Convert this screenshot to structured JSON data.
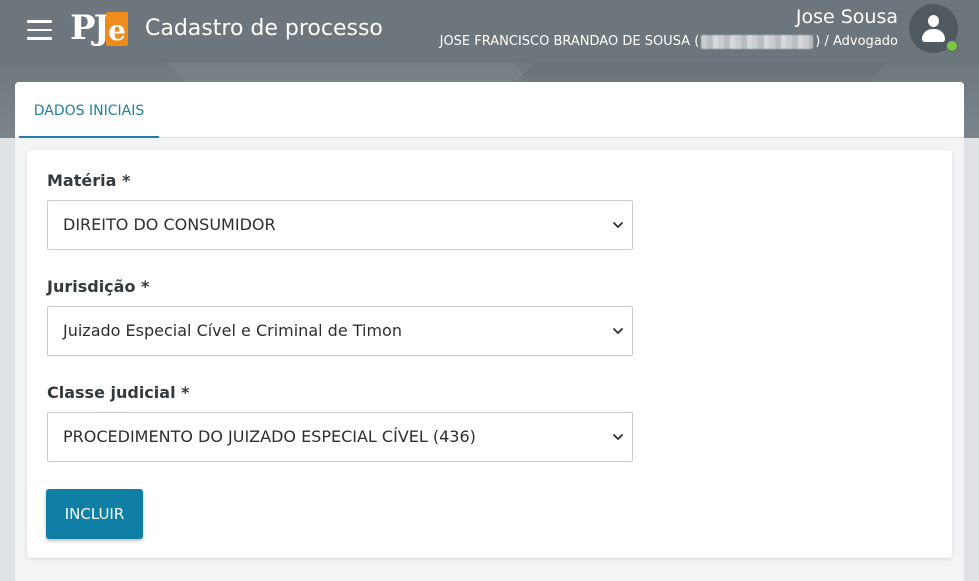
{
  "header": {
    "title": "Cadastro de processo",
    "logo_text": "PJe",
    "user_name": "Jose Sousa",
    "user_detail_prefix": "JOSE FRANCISCO BRANDAO DE SOUSA (",
    "user_detail_suffix": ") / Advogado",
    "status_color": "#7ac943"
  },
  "tabs": [
    {
      "label": "DADOS INICIAIS",
      "active": true
    }
  ],
  "form": {
    "materia": {
      "label": "Matéria *",
      "value": "DIREITO DO CONSUMIDOR"
    },
    "jurisdicao": {
      "label": "Jurisdição *",
      "value": "Juizado Especial Cível e Criminal de Timon"
    },
    "classe": {
      "label": "Classe judicial *",
      "value": "PROCEDIMENTO DO JUIZADO ESPECIAL CÍVEL (436)"
    },
    "submit_label": "INCLUIR"
  },
  "colors": {
    "topbar": "#6d767c",
    "accent": "#0f7fa6",
    "logo_orange": "#f08c1c"
  }
}
